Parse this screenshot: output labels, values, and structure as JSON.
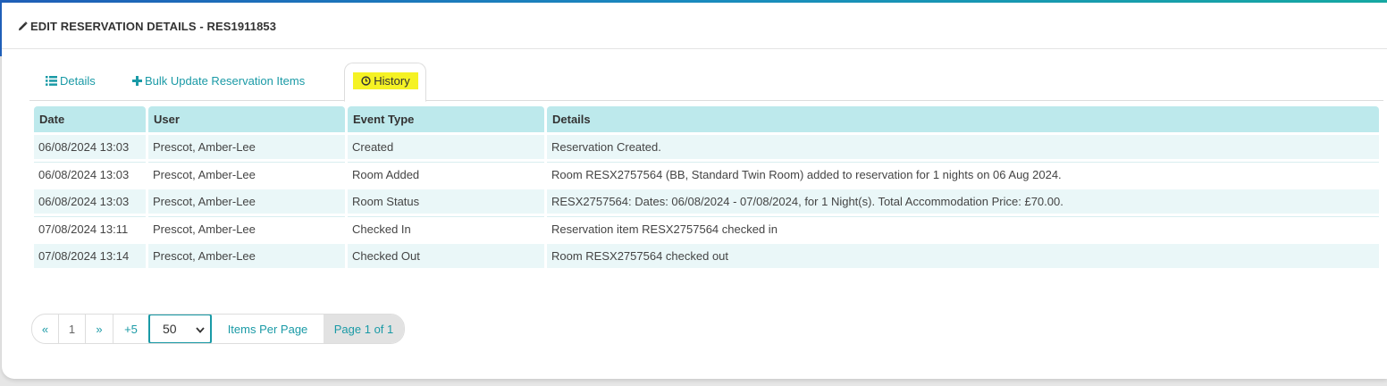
{
  "header": {
    "title": "EDIT RESERVATION DETAILS - RES1911853",
    "icon": "pencil-icon"
  },
  "tabs": [
    {
      "label": "Details",
      "icon": "list-icon",
      "active": false
    },
    {
      "label": "Bulk Update Reservation Items",
      "icon": "plus-icon",
      "active": false
    },
    {
      "label": "History",
      "icon": "clock-icon",
      "active": true
    }
  ],
  "table": {
    "headers": [
      "Date",
      "User",
      "Event Type",
      "Details"
    ],
    "rows": [
      {
        "date": "06/08/2024 13:03",
        "user": "Prescot, Amber-Lee",
        "event": "Created",
        "details": "Reservation Created."
      },
      {
        "date": "06/08/2024 13:03",
        "user": "Prescot, Amber-Lee",
        "event": "Room Added",
        "details": "Room RESX2757564 (BB, Standard Twin Room) added to reservation for 1 nights on 06 Aug 2024."
      },
      {
        "date": "06/08/2024 13:03",
        "user": "Prescot, Amber-Lee",
        "event": "Room Status",
        "details": "RESX2757564: Dates: 06/08/2024 - 07/08/2024, for 1 Night(s). Total Accommodation Price: £70.00."
      },
      {
        "date": "07/08/2024 13:11",
        "user": "Prescot, Amber-Lee",
        "event": "Checked In",
        "details": "Reservation item RESX2757564 checked in"
      },
      {
        "date": "07/08/2024 13:14",
        "user": "Prescot, Amber-Lee",
        "event": "Checked Out",
        "details": "Room RESX2757564 checked out"
      }
    ]
  },
  "pagination": {
    "prev": "«",
    "page": "1",
    "next": "»",
    "plus5": "+5",
    "per_page": "50",
    "per_page_label": "Items Per Page",
    "page_info": "Page 1 of 1"
  },
  "colors": {
    "accent": "#1a9aa6",
    "header_bg": "#bde9ec",
    "row_alt": "#eaf7f8",
    "highlight": "#f5f224"
  }
}
